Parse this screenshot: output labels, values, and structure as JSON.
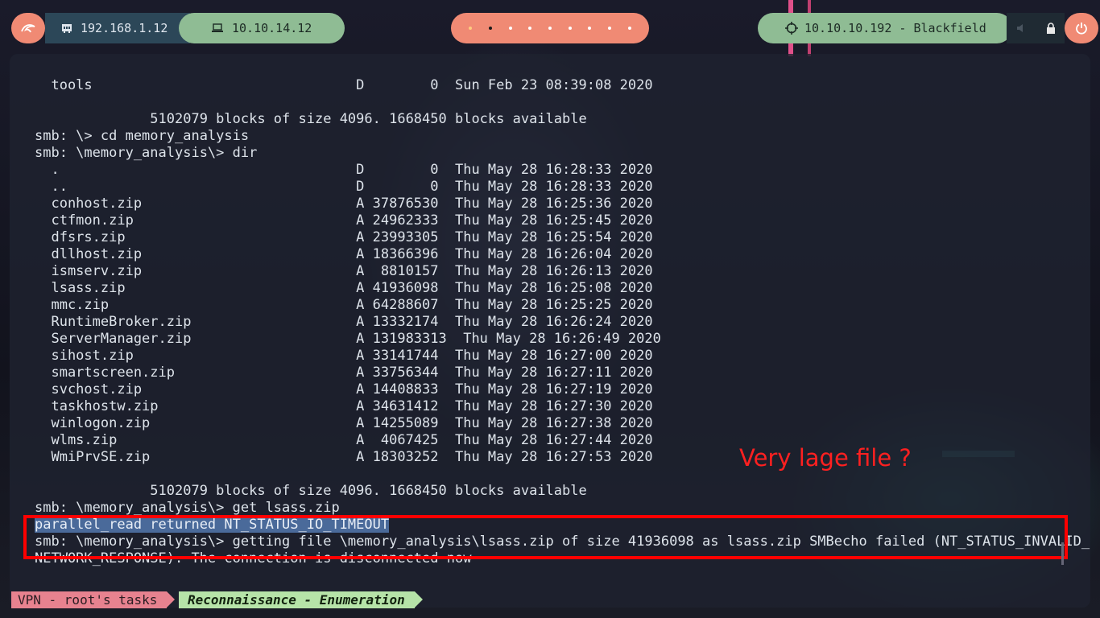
{
  "topbar": {
    "logo_icon": "kali-dragon-icon",
    "host_ip": "192.168.1.12",
    "vpn_ip": "10.10.14.12",
    "workspace_count": 10,
    "active_workspace": 2,
    "target": "10.10.10.192 - Blackfield",
    "power_icon": "power-icon"
  },
  "terminal": {
    "lines": [
      "  tools                                D        0  Sun Feb 23 08:39:08 2020",
      "",
      "              5102079 blocks of size 4096. 1668450 blocks available",
      "smb: \\> cd memory_analysis",
      "smb: \\memory_analysis\\> dir",
      "  .                                    D        0  Thu May 28 16:28:33 2020",
      "  ..                                   D        0  Thu May 28 16:28:33 2020",
      "  conhost.zip                          A 37876530  Thu May 28 16:25:36 2020",
      "  ctfmon.zip                           A 24962333  Thu May 28 16:25:45 2020",
      "  dfsrs.zip                            A 23993305  Thu May 28 16:25:54 2020",
      "  dllhost.zip                          A 18366396  Thu May 28 16:26:04 2020",
      "  ismserv.zip                          A  8810157  Thu May 28 16:26:13 2020",
      "  lsass.zip                            A 41936098  Thu May 28 16:25:08 2020",
      "  mmc.zip                              A 64288607  Thu May 28 16:25:25 2020",
      "  RuntimeBroker.zip                    A 13332174  Thu May 28 16:26:24 2020",
      "  ServerManager.zip                    A 131983313  Thu May 28 16:26:49 2020",
      "  sihost.zip                           A 33141744  Thu May 28 16:27:00 2020",
      "  smartscreen.zip                      A 33756344  Thu May 28 16:27:11 2020",
      "  svchost.zip                          A 14408833  Thu May 28 16:27:19 2020",
      "  taskhostw.zip                        A 34631412  Thu May 28 16:27:30 2020",
      "  winlogon.zip                         A 14255089  Thu May 28 16:27:38 2020",
      "  wlms.zip                             A  4067425  Thu May 28 16:27:44 2020",
      "  WmiPrvSE.zip                         A 18303252  Thu May 28 16:27:53 2020",
      "",
      "              5102079 blocks of size 4096. 1668450 blocks available",
      "smb: \\memory_analysis\\> get lsass.zip",
      "parallel_read returned NT_STATUS_IO_TIMEOUT",
      "smb: \\memory_analysis\\> getting file \\memory_analysis\\lsass.zip of size 41936098 as lsass.zip SMBecho failed (NT_STATUS_INVALID_",
      "NETWORK_RESPONSE). The connection is disconnected now"
    ],
    "selected_line_index": 26,
    "annotation": "Very lage file ?",
    "highlight_color": "#ff0000"
  },
  "statusbar": {
    "session": "VPN - root's tasks",
    "window_title": "Reconnaissance - Enumeration"
  }
}
